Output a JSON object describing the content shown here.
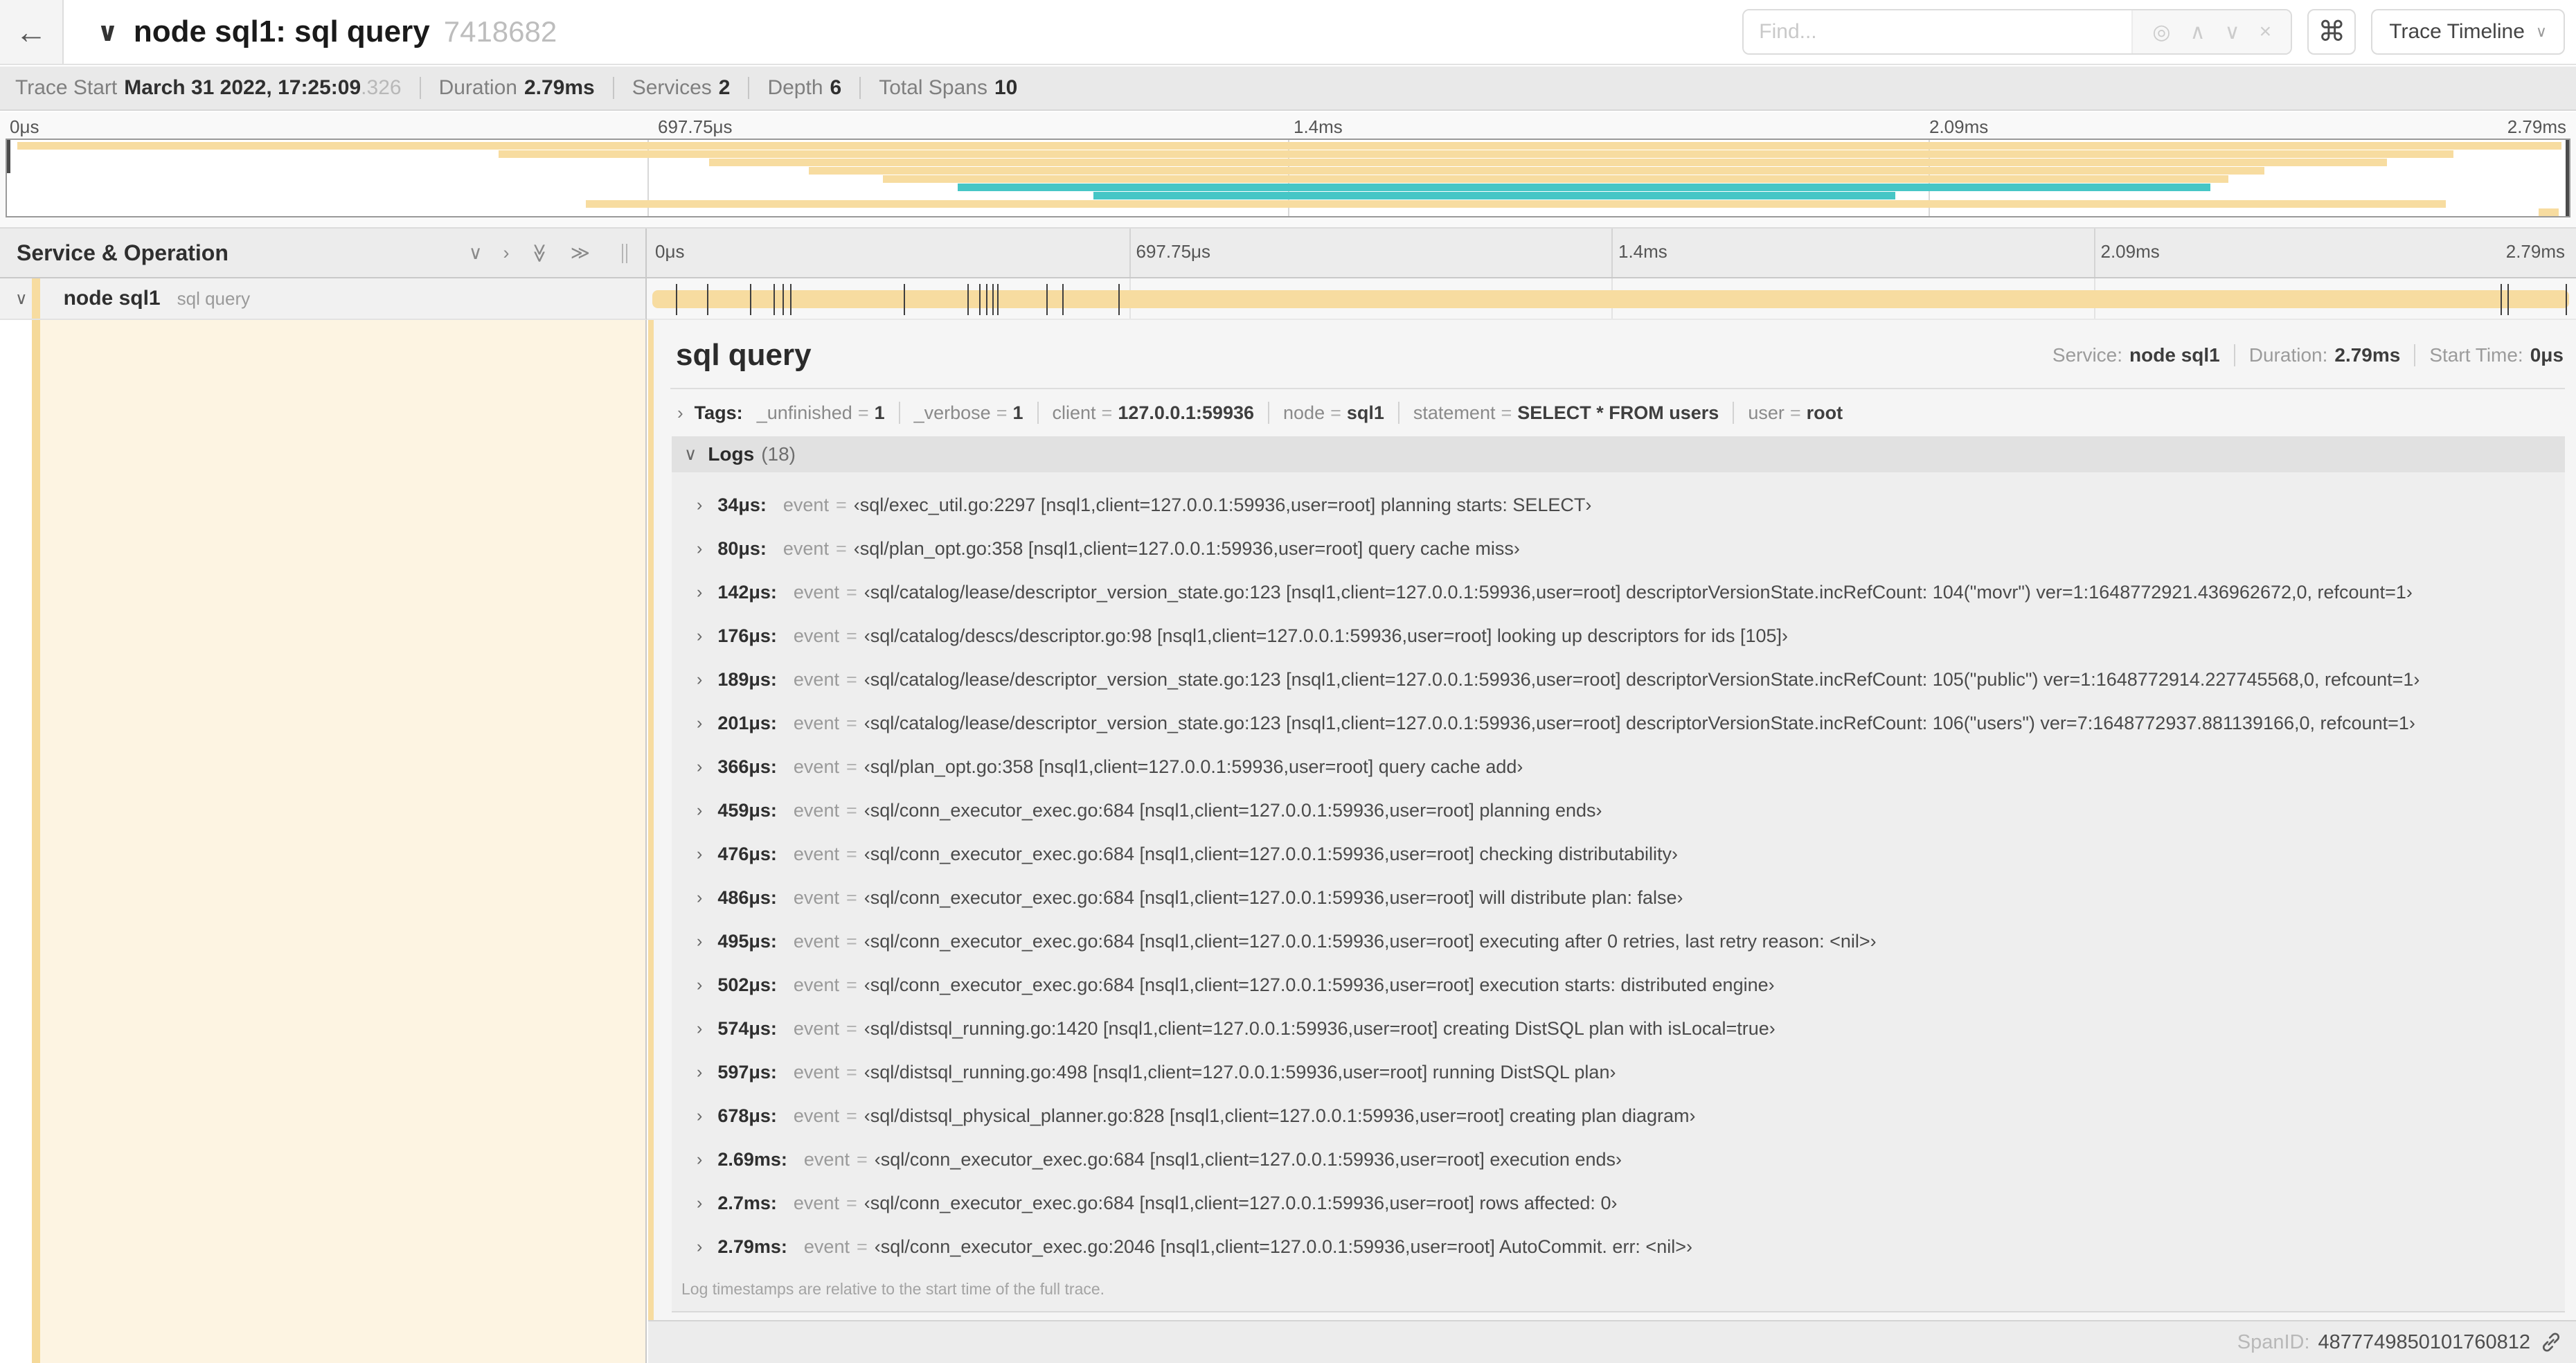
{
  "header": {
    "back_icon": "←",
    "collapse_icon": "∨",
    "title": "node sql1: sql query",
    "trace_id": "7418682",
    "find_placeholder": "Find...",
    "find_icons": {
      "target": "◎",
      "prev": "∧",
      "next": "∨",
      "clear": "×"
    },
    "shortcut_icon": "⌘",
    "view_selector": "Trace Timeline",
    "dropdown_icon": "∨"
  },
  "trace_info": {
    "items": [
      {
        "label": "Trace Start",
        "value": "March 31 2022, 17:25:09",
        "suffix": ".326"
      },
      {
        "label": "Duration",
        "value": "2.79ms"
      },
      {
        "label": "Services",
        "value": "2"
      },
      {
        "label": "Depth",
        "value": "6"
      },
      {
        "label": "Total Spans",
        "value": "10"
      }
    ]
  },
  "minimap": {
    "tick_labels": [
      "0μs",
      "697.75μs",
      "1.4ms",
      "2.09ms",
      "2.79ms"
    ],
    "spans": [
      {
        "left": 0.4,
        "width": 99.3,
        "color": "tan"
      },
      {
        "left": 19.2,
        "width": 76.3,
        "color": "tan"
      },
      {
        "left": 27.4,
        "width": 65.5,
        "color": "tan"
      },
      {
        "left": 31.3,
        "width": 56.8,
        "color": "tan"
      },
      {
        "left": 34.2,
        "width": 52.5,
        "color": "tan"
      },
      {
        "left": 37.1,
        "width": 48.9,
        "color": "teal"
      },
      {
        "left": 42.4,
        "width": 31.3,
        "color": "teal"
      },
      {
        "left": 22.6,
        "width": 72.6,
        "color": "tan"
      },
      {
        "left": 98.8,
        "width": 0.8,
        "color": "tan"
      }
    ]
  },
  "timeline": {
    "column_header": "Service & Operation",
    "collapse_icons": {
      "collapse_one": "∨",
      "expand_one": "›",
      "collapse_all": "≫",
      "expand_all": "≫"
    },
    "tick_labels": [
      "0μs",
      "697.75μs",
      "1.4ms",
      "2.09ms",
      "2.79ms"
    ],
    "total_us": 2790,
    "log_ticks_us": [
      34,
      80,
      142,
      176,
      189,
      201,
      366,
      459,
      476,
      486,
      495,
      502,
      574,
      597,
      678,
      2690,
      2700,
      2785
    ]
  },
  "span_row": {
    "chevron": "∨",
    "service": "node sql1",
    "operation": "sql query"
  },
  "detail": {
    "title": "sql query",
    "meta": [
      {
        "label": "Service:",
        "value": "node sql1"
      },
      {
        "label": "Duration:",
        "value": "2.79ms"
      },
      {
        "label": "Start Time:",
        "value": "0μs"
      }
    ],
    "tags_chevron": "›",
    "tags_label": "Tags:",
    "tags": [
      {
        "key": "_unfinished",
        "value": "1"
      },
      {
        "key": "_verbose",
        "value": "1"
      },
      {
        "key": "client",
        "value": "127.0.0.1:59936"
      },
      {
        "key": "node",
        "value": "sql1"
      },
      {
        "key": "statement",
        "value": "SELECT * FROM users"
      },
      {
        "key": "user",
        "value": "root"
      }
    ],
    "logs_chevron": "∨",
    "logs_label": "Logs",
    "logs_count": "(18)",
    "log_field": "event",
    "logs": [
      {
        "time": "34μs:",
        "value": "‹sql/exec_util.go:2297 [nsql1,client=127.0.0.1:59936,user=root] planning starts: SELECT›"
      },
      {
        "time": "80μs:",
        "value": "‹sql/plan_opt.go:358 [nsql1,client=127.0.0.1:59936,user=root] query cache miss›"
      },
      {
        "time": "142μs:",
        "value": "‹sql/catalog/lease/descriptor_version_state.go:123 [nsql1,client=127.0.0.1:59936,user=root] descriptorVersionState.incRefCount: 104(\"movr\") ver=1:1648772921.436962672,0, refcount=1›"
      },
      {
        "time": "176μs:",
        "value": "‹sql/catalog/descs/descriptor.go:98 [nsql1,client=127.0.0.1:59936,user=root] looking up descriptors for ids [105]›"
      },
      {
        "time": "189μs:",
        "value": "‹sql/catalog/lease/descriptor_version_state.go:123 [nsql1,client=127.0.0.1:59936,user=root] descriptorVersionState.incRefCount: 105(\"public\") ver=1:1648772914.227745568,0, refcount=1›"
      },
      {
        "time": "201μs:",
        "value": "‹sql/catalog/lease/descriptor_version_state.go:123 [nsql1,client=127.0.0.1:59936,user=root] descriptorVersionState.incRefCount: 106(\"users\") ver=7:1648772937.881139166,0, refcount=1›"
      },
      {
        "time": "366μs:",
        "value": "‹sql/plan_opt.go:358 [nsql1,client=127.0.0.1:59936,user=root] query cache add›"
      },
      {
        "time": "459μs:",
        "value": "‹sql/conn_executor_exec.go:684 [nsql1,client=127.0.0.1:59936,user=root] planning ends›"
      },
      {
        "time": "476μs:",
        "value": "‹sql/conn_executor_exec.go:684 [nsql1,client=127.0.0.1:59936,user=root] checking distributability›"
      },
      {
        "time": "486μs:",
        "value": "‹sql/conn_executor_exec.go:684 [nsql1,client=127.0.0.1:59936,user=root] will distribute plan: false›"
      },
      {
        "time": "495μs:",
        "value": "‹sql/conn_executor_exec.go:684 [nsql1,client=127.0.0.1:59936,user=root] executing after 0 retries, last retry reason: <nil>›"
      },
      {
        "time": "502μs:",
        "value": "‹sql/conn_executor_exec.go:684 [nsql1,client=127.0.0.1:59936,user=root] execution starts: distributed engine›"
      },
      {
        "time": "574μs:",
        "value": "‹sql/distsql_running.go:1420 [nsql1,client=127.0.0.1:59936,user=root] creating DistSQL plan with isLocal=true›"
      },
      {
        "time": "597μs:",
        "value": "‹sql/distsql_running.go:498 [nsql1,client=127.0.0.1:59936,user=root] running DistSQL plan›"
      },
      {
        "time": "678μs:",
        "value": "‹sql/distsql_physical_planner.go:828 [nsql1,client=127.0.0.1:59936,user=root] creating plan diagram›"
      },
      {
        "time": "2.69ms:",
        "value": "‹sql/conn_executor_exec.go:684 [nsql1,client=127.0.0.1:59936,user=root] execution ends›"
      },
      {
        "time": "2.7ms:",
        "value": "‹sql/conn_executor_exec.go:684 [nsql1,client=127.0.0.1:59936,user=root] rows affected: 0›"
      },
      {
        "time": "2.79ms:",
        "value": "‹sql/conn_executor_exec.go:2046 [nsql1,client=127.0.0.1:59936,user=root] AutoCommit. err: <nil>›"
      }
    ],
    "footnote": "Log timestamps are relative to the start time of the full trace.",
    "span_id_label": "SpanID:",
    "span_id": "4877749850101760812"
  },
  "colors": {
    "span_tan": "#f7dca0",
    "span_teal": "#46c6c6",
    "selection_cream": "#fdf4e2"
  }
}
